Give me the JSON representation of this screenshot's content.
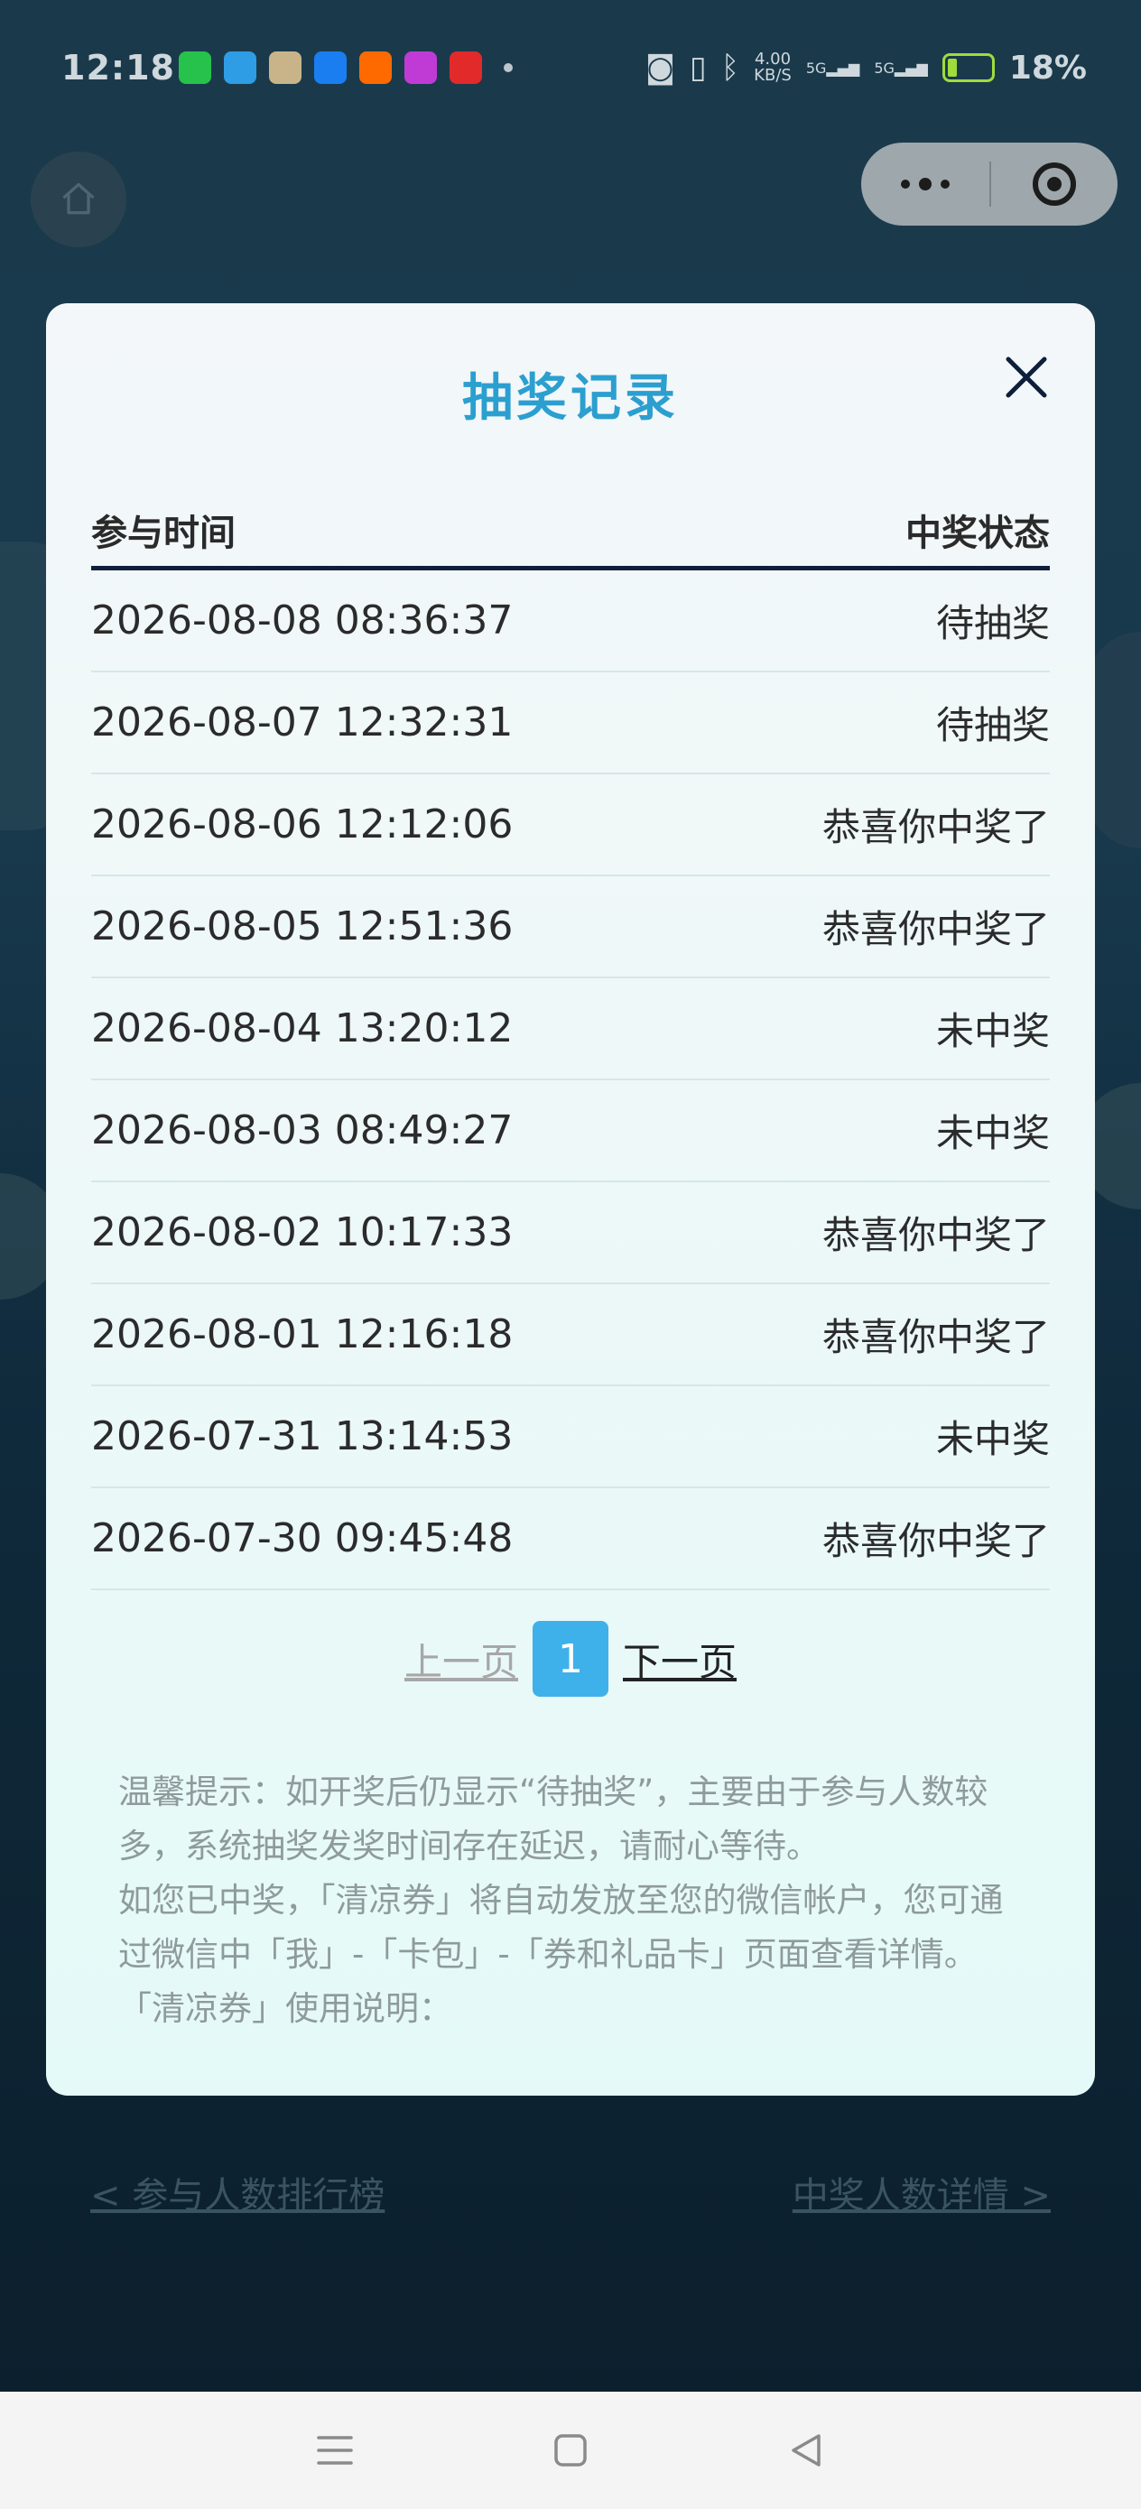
{
  "status_bar": {
    "time": "12:18",
    "network_speed_value": "4.00",
    "network_speed_unit": "KB/S",
    "signal1_label": "5G",
    "signal2_label": "5G",
    "battery": "18%"
  },
  "modal": {
    "title": "抽奖记录",
    "col_time": "参与时间",
    "col_status": "中奖状态",
    "rows": [
      {
        "time": "2026-08-08 08:36:37",
        "status": "待抽奖"
      },
      {
        "time": "2026-08-07 12:32:31",
        "status": "待抽奖"
      },
      {
        "time": "2026-08-06 12:12:06",
        "status": "恭喜你中奖了"
      },
      {
        "time": "2026-08-05 12:51:36",
        "status": "恭喜你中奖了"
      },
      {
        "time": "2026-08-04 13:20:12",
        "status": "未中奖"
      },
      {
        "time": "2026-08-03 08:49:27",
        "status": "未中奖"
      },
      {
        "time": "2026-08-02 10:17:33",
        "status": "恭喜你中奖了"
      },
      {
        "time": "2026-08-01 12:16:18",
        "status": "恭喜你中奖了"
      },
      {
        "time": "2026-07-31 13:14:53",
        "status": "未中奖"
      },
      {
        "time": "2026-07-30 09:45:48",
        "status": "恭喜你中奖了"
      }
    ],
    "pager": {
      "prev": "上一页",
      "current": "1",
      "next": "下一页"
    },
    "tips": [
      "温馨提示：如开奖后仍显示“待抽奖”，主要由于参与人数较多，系统抽奖发奖时间存在延迟，请耐心等待。",
      "如您已中奖，「清凉券」将自动发放至您的微信帐户，您可通过微信中「我」-「卡包」-「券和礼品卡」页面查看详情。",
      "「清凉券」使用说明："
    ]
  },
  "background_links": {
    "left": "< 参与人数排行榜",
    "right": "中奖人数详情 >"
  },
  "colors": {
    "title": "#2b9fcf",
    "page_active": "#3fb1ea",
    "header_rule": "#0e1f3b"
  }
}
